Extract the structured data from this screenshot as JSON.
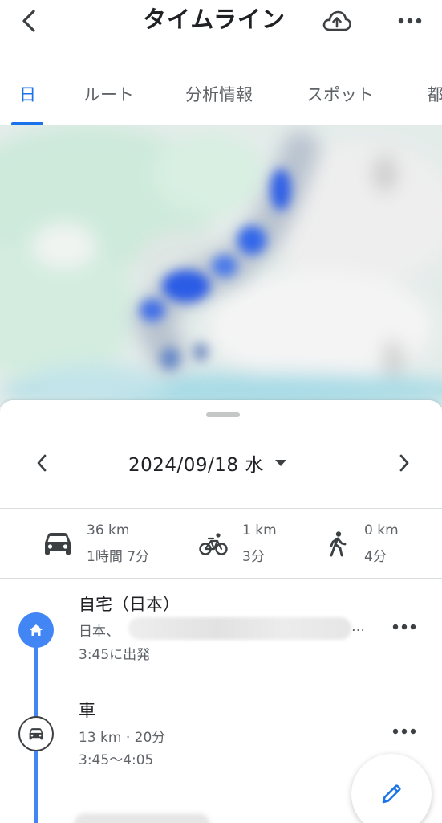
{
  "header": {
    "title": "タイムライン"
  },
  "tabs": [
    {
      "label": "日",
      "active": true
    },
    {
      "label": "ルート",
      "active": false
    },
    {
      "label": "分析情報",
      "active": false
    },
    {
      "label": "スポット",
      "active": false
    },
    {
      "label": "都",
      "active": false
    }
  ],
  "date_nav": {
    "date": "2024/09/18 水"
  },
  "stats": {
    "car": {
      "distance": "36 km",
      "duration": "1時間 7分"
    },
    "bike": {
      "distance": "1 km",
      "duration": "3分"
    },
    "walk": {
      "distance": "0 km",
      "duration": "4分"
    }
  },
  "timeline": {
    "home": {
      "title": "自宅（日本）",
      "address_prefix": "日本、",
      "address_ellipsis": "…",
      "departure": "3:45に出発"
    },
    "car": {
      "title": "車",
      "summary": "13 km · 20分",
      "time_range": "3:45〜4:05"
    }
  },
  "colors": {
    "accent": "#1a73e8",
    "timeline_line": "#4285f4",
    "map_heat": "#2b5fe8"
  },
  "icons": {
    "back": "chevron-left-icon",
    "cloud": "cloud-upload-icon",
    "more": "more-horizontal-icon",
    "prev": "chevron-left-icon",
    "next": "chevron-right-icon",
    "dropdown": "caret-down-icon",
    "car": "car-icon",
    "bike": "bicycle-icon",
    "walk": "walking-icon",
    "home": "home-icon",
    "edit": "pencil-icon"
  }
}
